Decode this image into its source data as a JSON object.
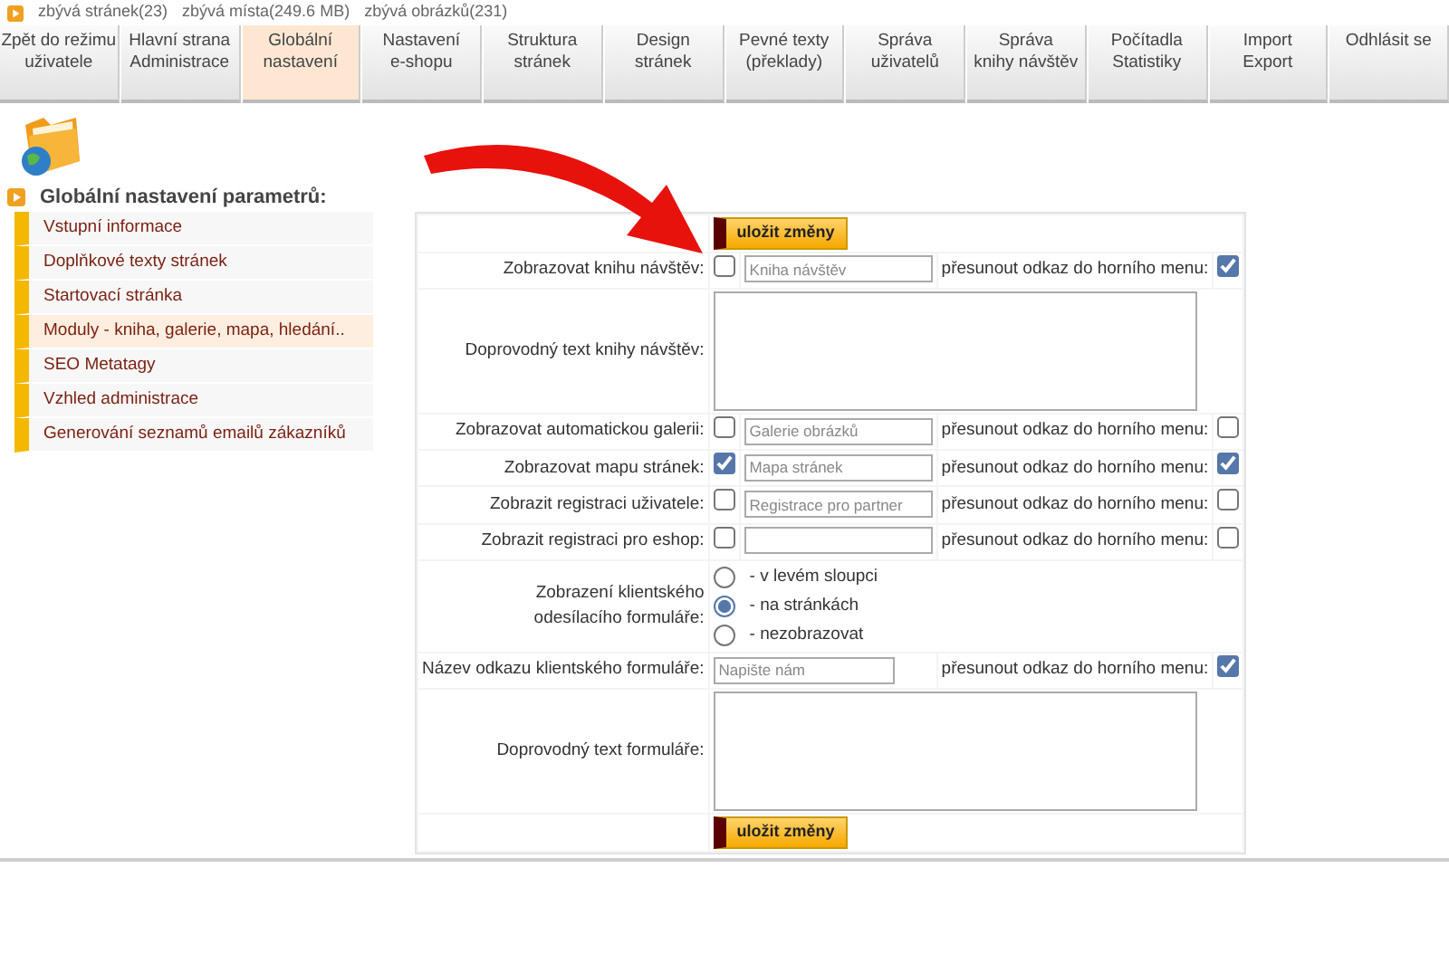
{
  "top_info": {
    "items": [
      "zbývá stránek(23)",
      "zbývá místa(249.6 MB)",
      "zbývá obrázků(231)"
    ]
  },
  "tabs": [
    {
      "lines": [
        "Zpět do režimu",
        "uživatele"
      ],
      "selected": false
    },
    {
      "lines": [
        "Hlavní strana",
        "Administrace"
      ],
      "selected": false
    },
    {
      "lines": [
        "Globální",
        "nastavení"
      ],
      "selected": true
    },
    {
      "lines": [
        "Nastavení",
        "e-shopu"
      ],
      "selected": false
    },
    {
      "lines": [
        "Struktura",
        "stránek"
      ],
      "selected": false
    },
    {
      "lines": [
        "Design",
        "stránek"
      ],
      "selected": false
    },
    {
      "lines": [
        "Pevné texty",
        "(překlady)"
      ],
      "selected": false
    },
    {
      "lines": [
        "Správa",
        "uživatelů"
      ],
      "selected": false
    },
    {
      "lines": [
        "Správa",
        "knihy návštěv"
      ],
      "selected": false
    },
    {
      "lines": [
        "Počítadla",
        "Statistiky"
      ],
      "selected": false
    },
    {
      "lines": [
        "Import",
        "Export"
      ],
      "selected": false
    },
    {
      "lines": [
        "Odhlásit se"
      ],
      "selected": false
    }
  ],
  "section_title": "Globální nastavení parametrů:",
  "sidebar": {
    "items": [
      {
        "label": "Vstupní informace",
        "selected": false
      },
      {
        "label": "Doplňkové texty stránek",
        "selected": false
      },
      {
        "label": "Startovací stránka",
        "selected": false
      },
      {
        "label": "Moduly - kniha, galerie, mapa, hledání..",
        "selected": true
      },
      {
        "label": "SEO Metatagy",
        "selected": false
      },
      {
        "label": "Vzhled administrace",
        "selected": false
      },
      {
        "label": "Generování seznamů emailů zákazníků",
        "selected": false
      }
    ]
  },
  "form": {
    "rows": [
      {
        "kind": "save",
        "button": "uložit změny"
      },
      {
        "kind": "toggle",
        "label": "Zobrazovat knihu návštěv:",
        "checked": false,
        "value": "Kniha návštěv",
        "move_label": "přesunout odkaz do horního menu:",
        "move_checked": true
      },
      {
        "kind": "textarea",
        "label": "Doprovodný text knihy návštěv:"
      },
      {
        "kind": "toggle",
        "label": "Zobrazovat automatickou galerii:",
        "checked": false,
        "value": "Galerie obrázků",
        "move_label": "přesunout odkaz do horního menu:",
        "move_checked": false
      },
      {
        "kind": "toggle",
        "label": "Zobrazovat mapu stránek:",
        "checked": true,
        "value": "Mapa stránek",
        "move_label": "přesunout odkaz do horního menu:",
        "move_checked": true
      },
      {
        "kind": "toggle",
        "label": "Zobrazit registraci uživatele:",
        "checked": false,
        "value": "Registrace pro partner",
        "move_label": "přesunout odkaz do horního menu:",
        "move_checked": false
      },
      {
        "kind": "toggle",
        "label": "Zobrazit registraci pro eshop:",
        "checked": false,
        "move_label": "přesunout odkaz do horního menu:",
        "move_checked": false
      },
      {
        "kind": "radio",
        "label": "Zobrazení klientského odesílacího formuláře:",
        "options": [
          {
            "label": "- v levém sloupci",
            "selected": false
          },
          {
            "label": "- na stránkách",
            "selected": true
          },
          {
            "label": "- nezobrazovat",
            "selected": false
          }
        ]
      },
      {
        "kind": "text",
        "label": "Název odkazu klientského formuláře:",
        "value": "Napište nám",
        "move_label": "přesunout odkaz do horního menu:",
        "move_checked": true
      },
      {
        "kind": "textarea",
        "label": "Doprovodný text formuláře:"
      },
      {
        "kind": "save",
        "button": "uložit změny"
      }
    ]
  }
}
